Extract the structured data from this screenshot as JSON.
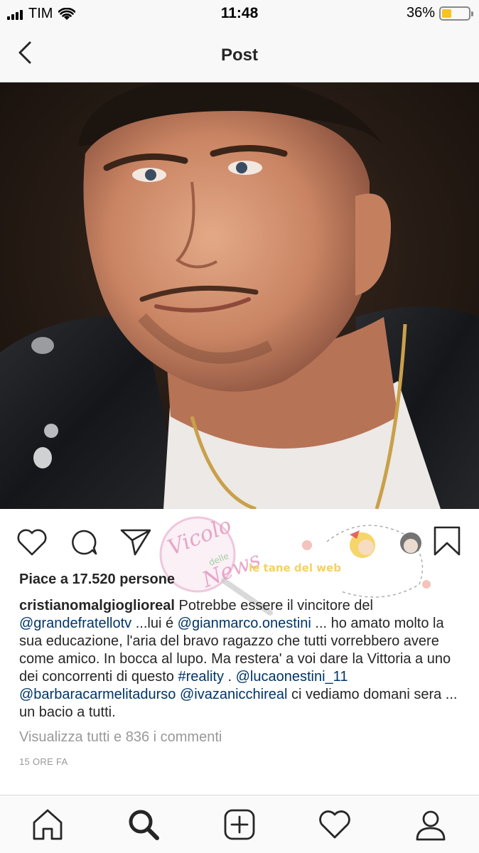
{
  "status_bar": {
    "carrier": "TIM",
    "time": "11:48",
    "battery_percent": "36%",
    "battery_level": 0.36
  },
  "nav": {
    "title": "Post",
    "back_icon": "chevron-left-icon"
  },
  "post": {
    "likes": "Piace a 17.520 persone",
    "caption": {
      "username": "cristianomalgioglioreal",
      "seg1": " Potrebbe essere il vincitore del ",
      "mention1": "@grandefratellotv",
      "seg2": " ...lui é ",
      "mention2": "@gianmarco.onestini",
      "seg3": " ... ho amato molto la sua educazione, l'aria del bravo ragazzo che tutti vorrebbero avere come amico. In bocca al lupo.  Ma restera' a voi dare la Vittoria a uno dei concorrenti di questo ",
      "hashtag": "#reality",
      "seg4": " . ",
      "mention3": "@lucaonestini_11",
      "seg5": " ",
      "mention4": "@barbaracarmelitadurso",
      "seg6": " ",
      "mention5": "@ivazanicchireal",
      "seg7": " ci vediamo domani sera ... un bacio a tutti."
    },
    "view_comments": "Visualizza tutti e 836 i commenti",
    "timestamp": "15 ORE FA"
  },
  "actions": [
    "heart-icon",
    "comment-icon",
    "share-icon",
    "bookmark-icon"
  ],
  "watermark": {
    "text1": "Vicolo",
    "text2": "delle",
    "text3": "News",
    "text4": "le tane del web"
  },
  "tab_bar": [
    "home-icon",
    "search-icon",
    "add-post-icon",
    "activity-heart-icon",
    "profile-icon"
  ],
  "colors": {
    "link": "#003569",
    "secondary_text": "#999999",
    "battery": "#f6c321"
  }
}
